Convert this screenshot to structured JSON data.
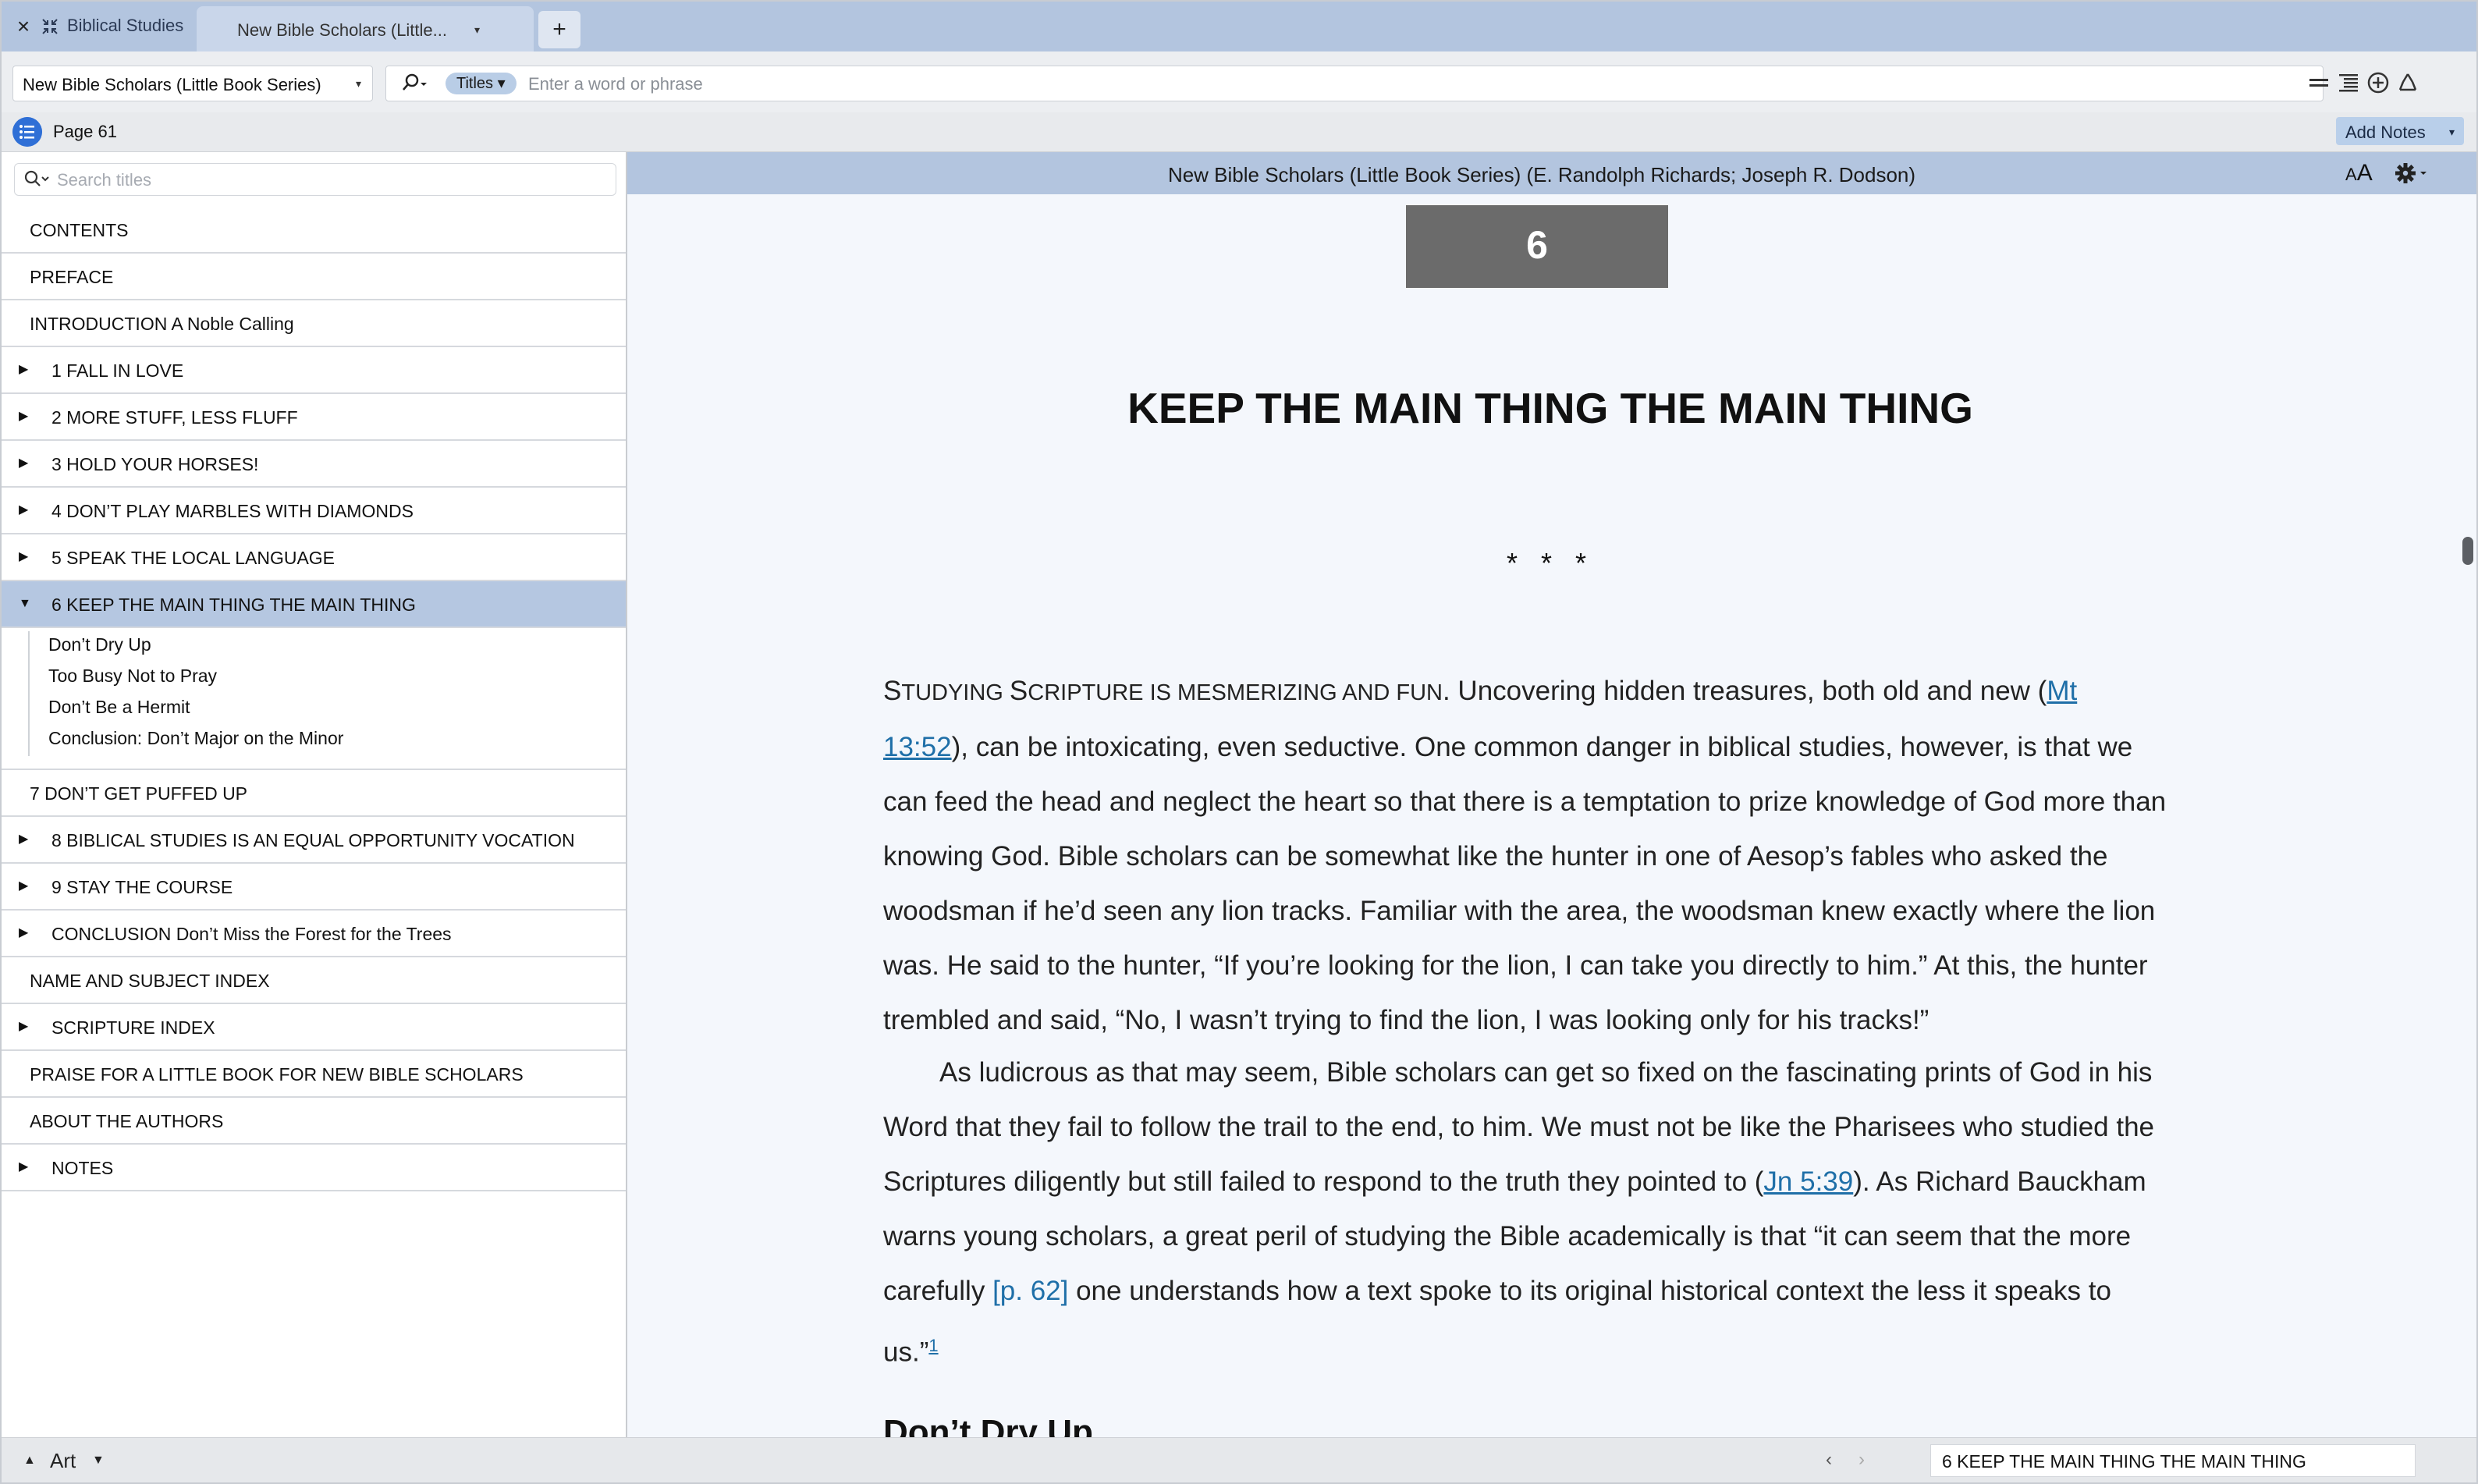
{
  "tabs": {
    "group_label": "Biblical Studies",
    "active_tab": "New Bible Scholars (Little...",
    "new_tab": "+"
  },
  "toolbar": {
    "resource": "New Bible Scholars (Little Book Series)",
    "scope": "Titles",
    "search_placeholder": "Enter a word or phrase"
  },
  "pagebar": {
    "page": "Page 61",
    "add_notes": "Add Notes"
  },
  "sidebar": {
    "search_placeholder": "Search titles",
    "toc": [
      {
        "label": "CONTENTS",
        "expandable": false
      },
      {
        "label": "PREFACE",
        "expandable": false
      },
      {
        "label": "INTRODUCTION A Noble Calling",
        "expandable": false
      },
      {
        "label": "1 FALL IN LOVE",
        "expandable": true
      },
      {
        "label": "2 MORE STUFF, LESS FLUFF",
        "expandable": true
      },
      {
        "label": "3 HOLD YOUR HORSES!",
        "expandable": true
      },
      {
        "label": "4 DON’T PLAY MARBLES WITH DIAMONDS",
        "expandable": true
      },
      {
        "label": "5 SPEAK THE LOCAL LANGUAGE",
        "expandable": true
      },
      {
        "label": "6 KEEP THE MAIN THING THE MAIN THING",
        "expandable": true,
        "active": true
      }
    ],
    "subitems": [
      "Don’t Dry Up",
      "Too Busy Not to Pray",
      "Don’t Be a Hermit",
      "Conclusion: Don’t Major on the Minor"
    ],
    "toc_after": [
      {
        "label": "7 DON’T GET PUFFED UP",
        "expandable": false
      },
      {
        "label": "8 BIBLICAL STUDIES IS AN EQUAL OPPORTUNITY VOCATION",
        "expandable": true
      },
      {
        "label": "9 STAY THE COURSE",
        "expandable": true
      },
      {
        "label": "CONCLUSION Don’t Miss the Forest for the Trees",
        "expandable": true
      },
      {
        "label": "NAME AND SUBJECT INDEX",
        "expandable": false
      },
      {
        "label": "SCRIPTURE INDEX",
        "expandable": true
      },
      {
        "label": "PRAISE FOR  A LITTLE BOOK FOR NEW BIBLE SCHOLARS",
        "expandable": false
      },
      {
        "label": "ABOUT THE AUTHORS",
        "expandable": false
      },
      {
        "label": "NOTES",
        "expandable": true
      }
    ]
  },
  "reader": {
    "header_title": "New Bible Scholars (Little Book Series) (E. Randolph Richards; Joseph R. Dodson)",
    "font_button": "AA",
    "chapter_number": "6",
    "chapter_title": "KEEP THE MAIN THING THE MAIN THING",
    "ornament": "* * *",
    "p1": {
      "lead_cap1": "S",
      "lead_small1": "TUDYING ",
      "lead_cap2": "S",
      "lead_small2": "CRIPTURE IS MESMERIZING AND FUN",
      "t1": ". Uncovering hidden treasures, both old and new (",
      "ref1": "Mt 13:52",
      "t2": "), can be intoxicating, even seductive. One common danger in biblical studies, however, is that we can feed the head and neglect the heart so that there is a temptation to prize knowledge of God more than knowing God. Bible scholars can be somewhat like the hunter in one of Aesop’s fables who asked the woodsman if he’d seen any lion tracks. Familiar with the area, the woodsman knew exactly where the lion was. He said to the hunter, “If you’re looking for the lion, I can take you directly to him.” At this, the hunter trembled and said, “No, I wasn’t trying to find the lion, I was looking only for his tracks!”"
    },
    "p2": {
      "t1": "As ludicrous as that may seem, Bible scholars can get so fixed on the fascinating prints of God in his Word that they fail to follow the trail to the end, to him. We must not be like the Pharisees who studied the Scriptures diligently but still failed to respond to the truth they pointed to (",
      "ref1": "Jn 5:39",
      "t2": "). As Richard Bauckham warns young scholars, a great peril of studying the Bible academically is that “it can seem that the more carefully ",
      "pagemark": "[p. 62]",
      "t3": " one understands how a text spoke to its original historical context the less it speaks to us.”",
      "footnote": "1"
    },
    "next_heading": "Don’t Dry Up"
  },
  "bottombar": {
    "art_label": "Art",
    "location": "6 KEEP THE MAIN THING THE MAIN THING"
  },
  "colors": {
    "tabbar": "#b3c5df",
    "active_row": "#b5c7e1",
    "link": "#1f6fa8",
    "chapter_box": "#6b6b6b"
  }
}
